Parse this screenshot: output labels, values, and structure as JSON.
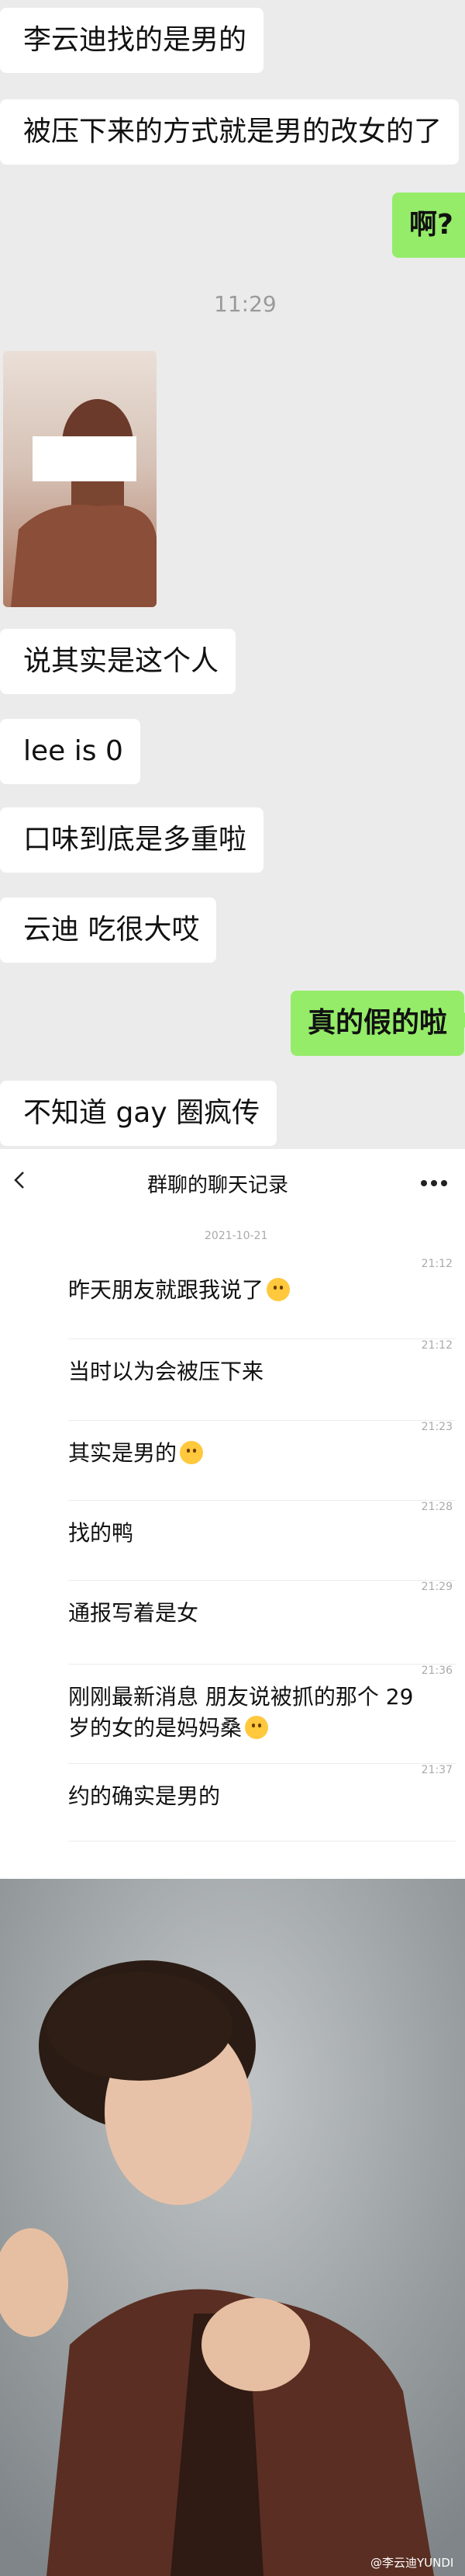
{
  "chat": {
    "messages": [
      {
        "text": "李云迪找的是男的",
        "side": "left"
      },
      {
        "text": "被压下来的方式就是男的改女的了",
        "side": "left"
      },
      {
        "text": "啊?",
        "side": "right"
      },
      {
        "text": "说其实是这个人",
        "side": "left"
      },
      {
        "text": "lee is 0",
        "side": "left"
      },
      {
        "text": "口味到底是多重啦",
        "side": "left"
      },
      {
        "text": "云迪 吃很大哎",
        "side": "left"
      },
      {
        "text": "真的假的啦",
        "side": "right"
      },
      {
        "text": "不知道 gay 圈疯传",
        "side": "left"
      }
    ],
    "timestamp": "11:29"
  },
  "history": {
    "title": "群聊的聊天记录",
    "date": "2021-10-21",
    "rows": [
      {
        "text": "昨天朋友就跟我说了",
        "time": "21:12",
        "emoji": true
      },
      {
        "text": "当时以为会被压下来",
        "time": "21:12",
        "emoji": false
      },
      {
        "text": "其实是男的",
        "time": "21:23",
        "emoji": true
      },
      {
        "text": "找的鸭",
        "time": "21:28",
        "emoji": false
      },
      {
        "text": "通报写着是女",
        "time": "21:29",
        "emoji": false
      },
      {
        "text": "刚刚最新消息 朋友说被抓的那个 29 岁的女的是妈妈桑",
        "time": "21:36",
        "emoji": true
      },
      {
        "text": "约的确实是男的",
        "time": "21:37",
        "emoji": false
      }
    ]
  },
  "watermark": "@李云迪YUNDI",
  "colors": {
    "chat_bg": "#ebebeb",
    "bubble_green": "#95ec69",
    "bubble_white": "#ffffff"
  }
}
